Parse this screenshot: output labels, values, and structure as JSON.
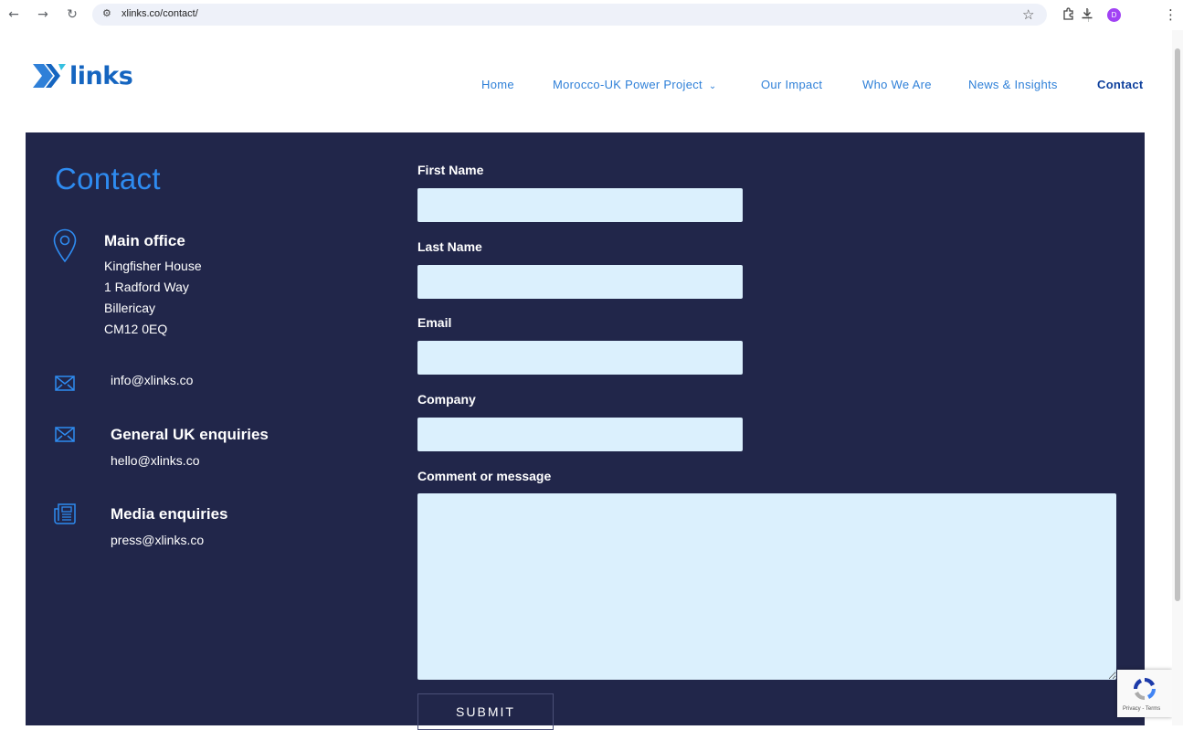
{
  "browser": {
    "url": "xlinks.co/contact/",
    "profile_initial": "D"
  },
  "header": {
    "logo_text": "links",
    "nav": [
      {
        "label": "Home"
      },
      {
        "label": "Morocco-UK Power Project"
      },
      {
        "label": "Our Impact"
      },
      {
        "label": "Who We Are"
      },
      {
        "label": "News & Insights"
      },
      {
        "label": "Contact"
      }
    ],
    "dropdown_glyph": "⌄"
  },
  "contact": {
    "title": "Contact",
    "main_office": {
      "heading": "Main office",
      "address": [
        "Kingfisher House",
        "1 Radford Way",
        "Billericay",
        "CM12 0EQ"
      ]
    },
    "info_email": "info@xlinks.co",
    "general": {
      "heading": "General UK enquiries",
      "email": "hello@xlinks.co"
    },
    "media": {
      "heading": "Media enquiries",
      "email": "press@xlinks.co"
    }
  },
  "form": {
    "first_name_label": "First Name",
    "last_name_label": "Last Name",
    "email_label": "Email",
    "company_label": "Company",
    "message_label": "Comment or message",
    "first_name_value": "",
    "last_name_value": "",
    "email_value": "",
    "company_value": "",
    "message_value": "",
    "submit_label": "SUBMIT"
  },
  "recaptcha": {
    "text": "Privacy - Terms"
  },
  "colors": {
    "panel": "#21264a",
    "field": "#dbf0fd",
    "accent": "#2e8bf0",
    "nav_link": "#2f80d8",
    "nav_active": "#0d3f9c"
  },
  "icons": [
    "location-pin-icon",
    "envelope-icon",
    "newspaper-icon",
    "back-arrow-icon",
    "forward-arrow-icon",
    "reload-icon",
    "site-settings-icon",
    "bookmark-star-icon",
    "extensions-icon",
    "download-icon",
    "menu-icon",
    "recaptcha-icon",
    "chevron-down-icon"
  ]
}
